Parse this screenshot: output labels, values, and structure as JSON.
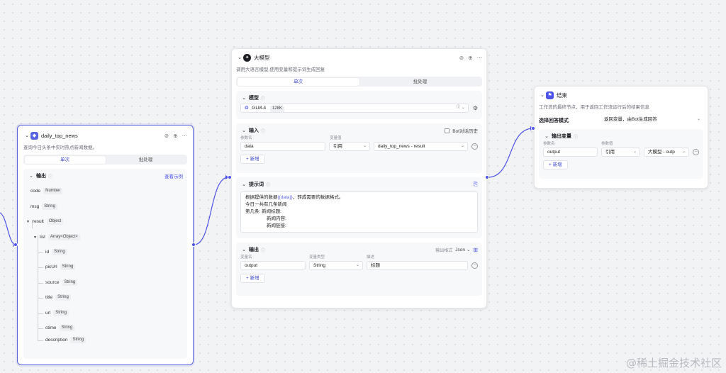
{
  "node_news": {
    "title": "daily_top_news",
    "desc": "查询今日头条中实时热点新闻数据。",
    "tabs": [
      "单次",
      "批处理"
    ],
    "output": {
      "title": "输出",
      "example_link": "查看示例",
      "fields": [
        {
          "name": "code",
          "type": "Number"
        },
        {
          "name": "msg",
          "type": "String"
        },
        {
          "name": "result",
          "type": "Object"
        },
        {
          "name": "list",
          "type": "Array<Object>"
        },
        {
          "name": "id",
          "type": "String"
        },
        {
          "name": "picUrl",
          "type": "String"
        },
        {
          "name": "source",
          "type": "String"
        },
        {
          "name": "title",
          "type": "String"
        },
        {
          "name": "url",
          "type": "String"
        },
        {
          "name": "ctime",
          "type": "String"
        },
        {
          "name": "description",
          "type": "String"
        }
      ]
    }
  },
  "node_llm": {
    "title": "大模型",
    "desc": "调用大语言模型,使用变量和提示词生成回复",
    "tabs": [
      "单次",
      "批处理"
    ],
    "model": {
      "title": "模型",
      "name": "GLM-4",
      "badge": "128K"
    },
    "input": {
      "title": "输入",
      "bot_history": "Bot对话历史",
      "col_name": "参数名",
      "col_value": "变量值",
      "param_name": "data",
      "ref_type": "引用",
      "ref_value": "daily_top_news - result",
      "add": "新增"
    },
    "prompt": {
      "title": "提示词",
      "line1_pre": "根据提供的数据",
      "line1_var": "{{data}}",
      "line1_post": "，转成需要的数据格式。",
      "line2": "今日一共有几条新闻",
      "line3": "第几条:    新闻标题:",
      "line4": "新闻内容:",
      "line5": "新闻链接:"
    },
    "output": {
      "title": "输出",
      "format_label": "输出格式",
      "format_value": "Json",
      "col_name": "变量名",
      "col_type": "变量类型",
      "col_desc": "描述",
      "var_name": "output",
      "var_type": "String",
      "var_desc": "标题",
      "add": "新增"
    }
  },
  "node_end": {
    "title": "结束",
    "desc": "工作流的最终节点，用于返回工作流运行后的结果信息",
    "mode_label": "选择回答模式",
    "mode_value": "返回变量，由Bot生成回答",
    "output": {
      "title": "输出变量",
      "col_name": "参数名",
      "col_value": "参数值",
      "var_name": "output",
      "ref_type": "引用",
      "ref_value": "大模型 - outp",
      "add": "新增"
    }
  },
  "watermark": "@稀土掘金技术社区",
  "colors": {
    "accent": "#4d53e8",
    "news_icon": "#5a63e0",
    "llm_icon": "#1c1d23",
    "end_icon": "#4d53e8"
  }
}
